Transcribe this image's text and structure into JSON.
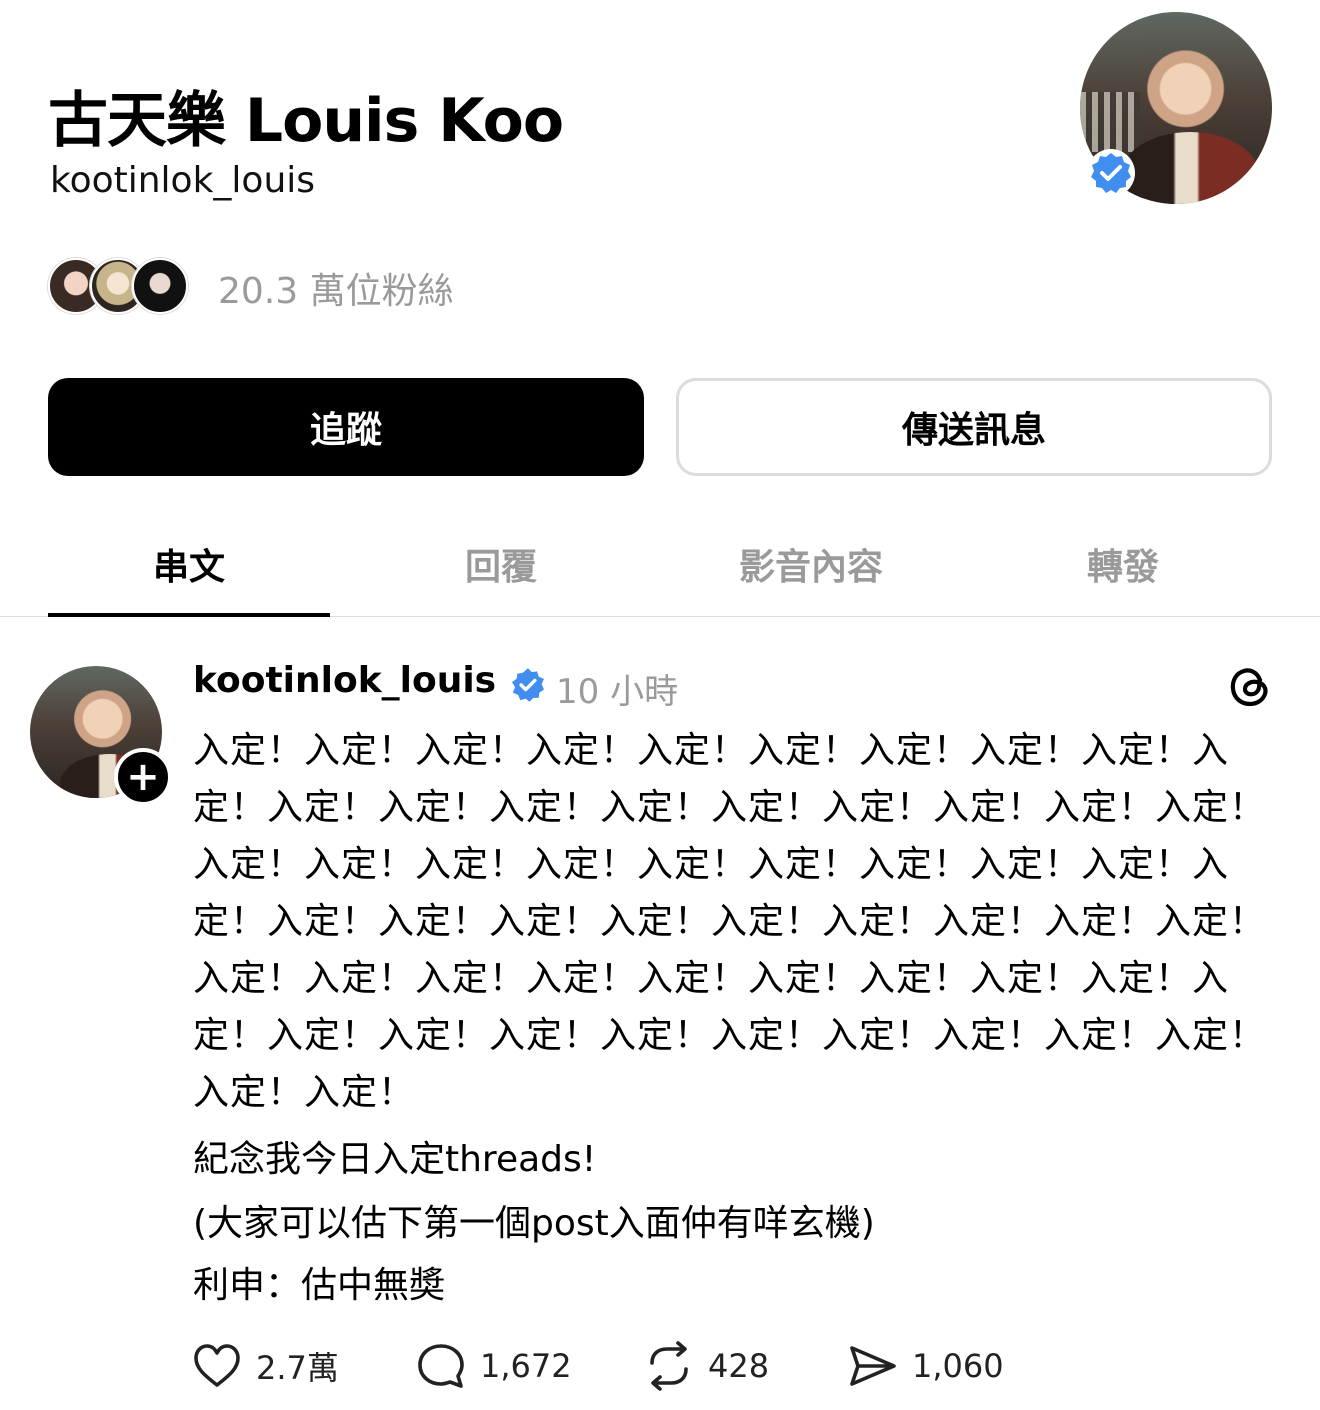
{
  "profile": {
    "display_name": "古天樂 Louis Koo",
    "handle": "kootinlok_louis",
    "avatar_icon": "profile-photo",
    "verified": true,
    "followers_text": "20.3 萬位粉絲"
  },
  "buttons": {
    "follow_label": "追蹤",
    "message_label": "傳送訊息"
  },
  "tabs": [
    {
      "label": "串文",
      "active": true
    },
    {
      "label": "回覆",
      "active": false
    },
    {
      "label": "影音內容",
      "active": false
    },
    {
      "label": "轉發",
      "active": false
    }
  ],
  "post": {
    "author": "kootinlok_louis",
    "time": "10 小時",
    "body": "入定！入定！入定！入定！入定！入定！入定！入定！入定！入定！入定！入定！入定！入定！入定！入定！入定！入定！入定！入定！入定！入定！入定！入定！入定！入定！入定！入定！入定！入定！入定！入定！入定！入定！入定！入定！入定！入定！入定！入定！入定！入定！入定！入定！入定！入定！入定！入定！入定！入定！入定！入定！入定！入定！入定！入定！入定！入定！入定！",
    "line1": "紀念我今日入定threads!",
    "line2": "(大家可以估下第一個post入面仲有咩玄機)",
    "line3": "利申：估中無奬",
    "likes": "2.7萬",
    "comments": "1,672",
    "reposts": "428",
    "shares": "1,060"
  },
  "colors": {
    "accent": "#000000",
    "muted": "#9a9a9a",
    "verified": "#3f8ef0"
  }
}
